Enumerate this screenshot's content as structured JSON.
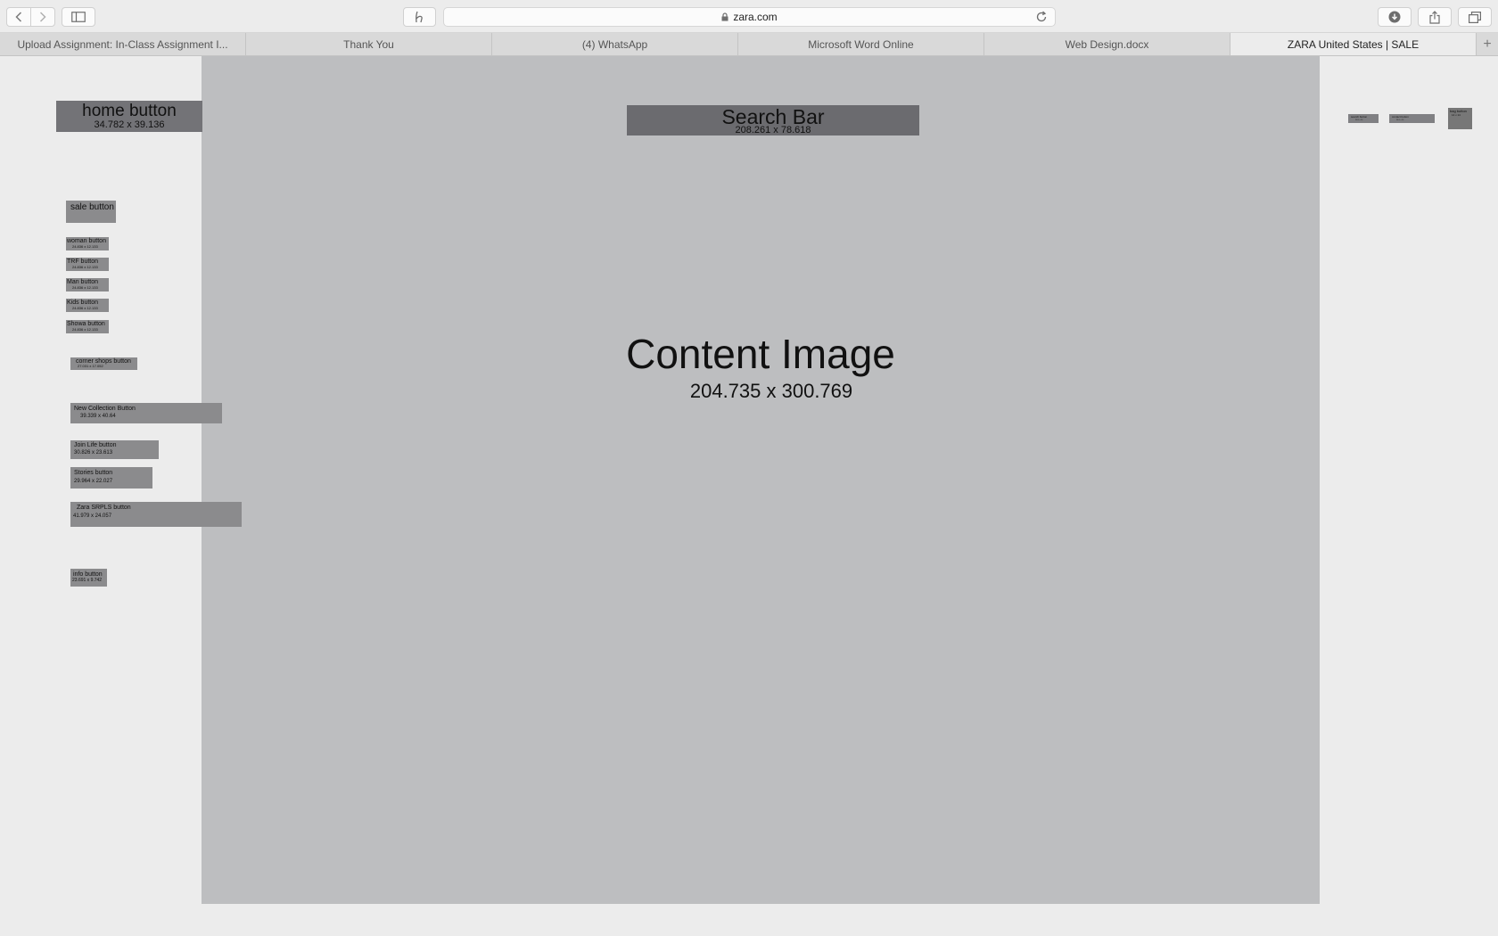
{
  "browser": {
    "url": "zara.com",
    "tabs": [
      {
        "label": "Upload Assignment: In-Class Assignment I..."
      },
      {
        "label": "Thank You"
      },
      {
        "label": "(4) WhatsApp"
      },
      {
        "label": "Microsoft Word Online"
      },
      {
        "label": "Web Design.docx"
      },
      {
        "label": "ZARA United States | SALE",
        "active": true
      }
    ],
    "add_tab_label": "+"
  },
  "wireframe": {
    "home_button": {
      "label": "home button",
      "dims": "34.782 x 39.136"
    },
    "search_bar": {
      "label": "Search Bar",
      "dims": "208.261 x 78.618"
    },
    "content_image": {
      "label": "Content Image",
      "dims": "204.735 x 300.769"
    },
    "sale_button": {
      "label": "sale button"
    },
    "categories": [
      {
        "label": "woman button",
        "dims": "24.836 x 12.133"
      },
      {
        "label": "TRF button",
        "dims": "24.836 x 12.133"
      },
      {
        "label": "Man button",
        "dims": "24.836 x 12.133"
      },
      {
        "label": "Kids button",
        "dims": "24.836 x 12.133"
      },
      {
        "label": "Showa button",
        "dims": "24.836 x 12.133"
      }
    ],
    "corner_shops": {
      "label": "corner shops button",
      "dims": "27.031 x 17.052"
    },
    "new_collection": {
      "label": "New Collection Button",
      "dims": "39.339 x 40.64"
    },
    "join_life": {
      "label": "Join Life button",
      "dims": "30.826 x 23.613"
    },
    "stories": {
      "label": "Stories button",
      "dims": "29.964 x 22.027"
    },
    "zara_srpls": {
      "label": "Zara SRPLS button",
      "dims": "41.979 x 24.057"
    },
    "info_button": {
      "label": "info button",
      "dims": "23.691 x 9.742"
    },
    "right_buttons": [
      {
        "label": "search button",
        "dims": "20.5 x 10"
      },
      {
        "label": "contact button",
        "dims": "26.5 x 10"
      },
      {
        "label": "bag button",
        "dims": "14 x 14"
      }
    ]
  }
}
